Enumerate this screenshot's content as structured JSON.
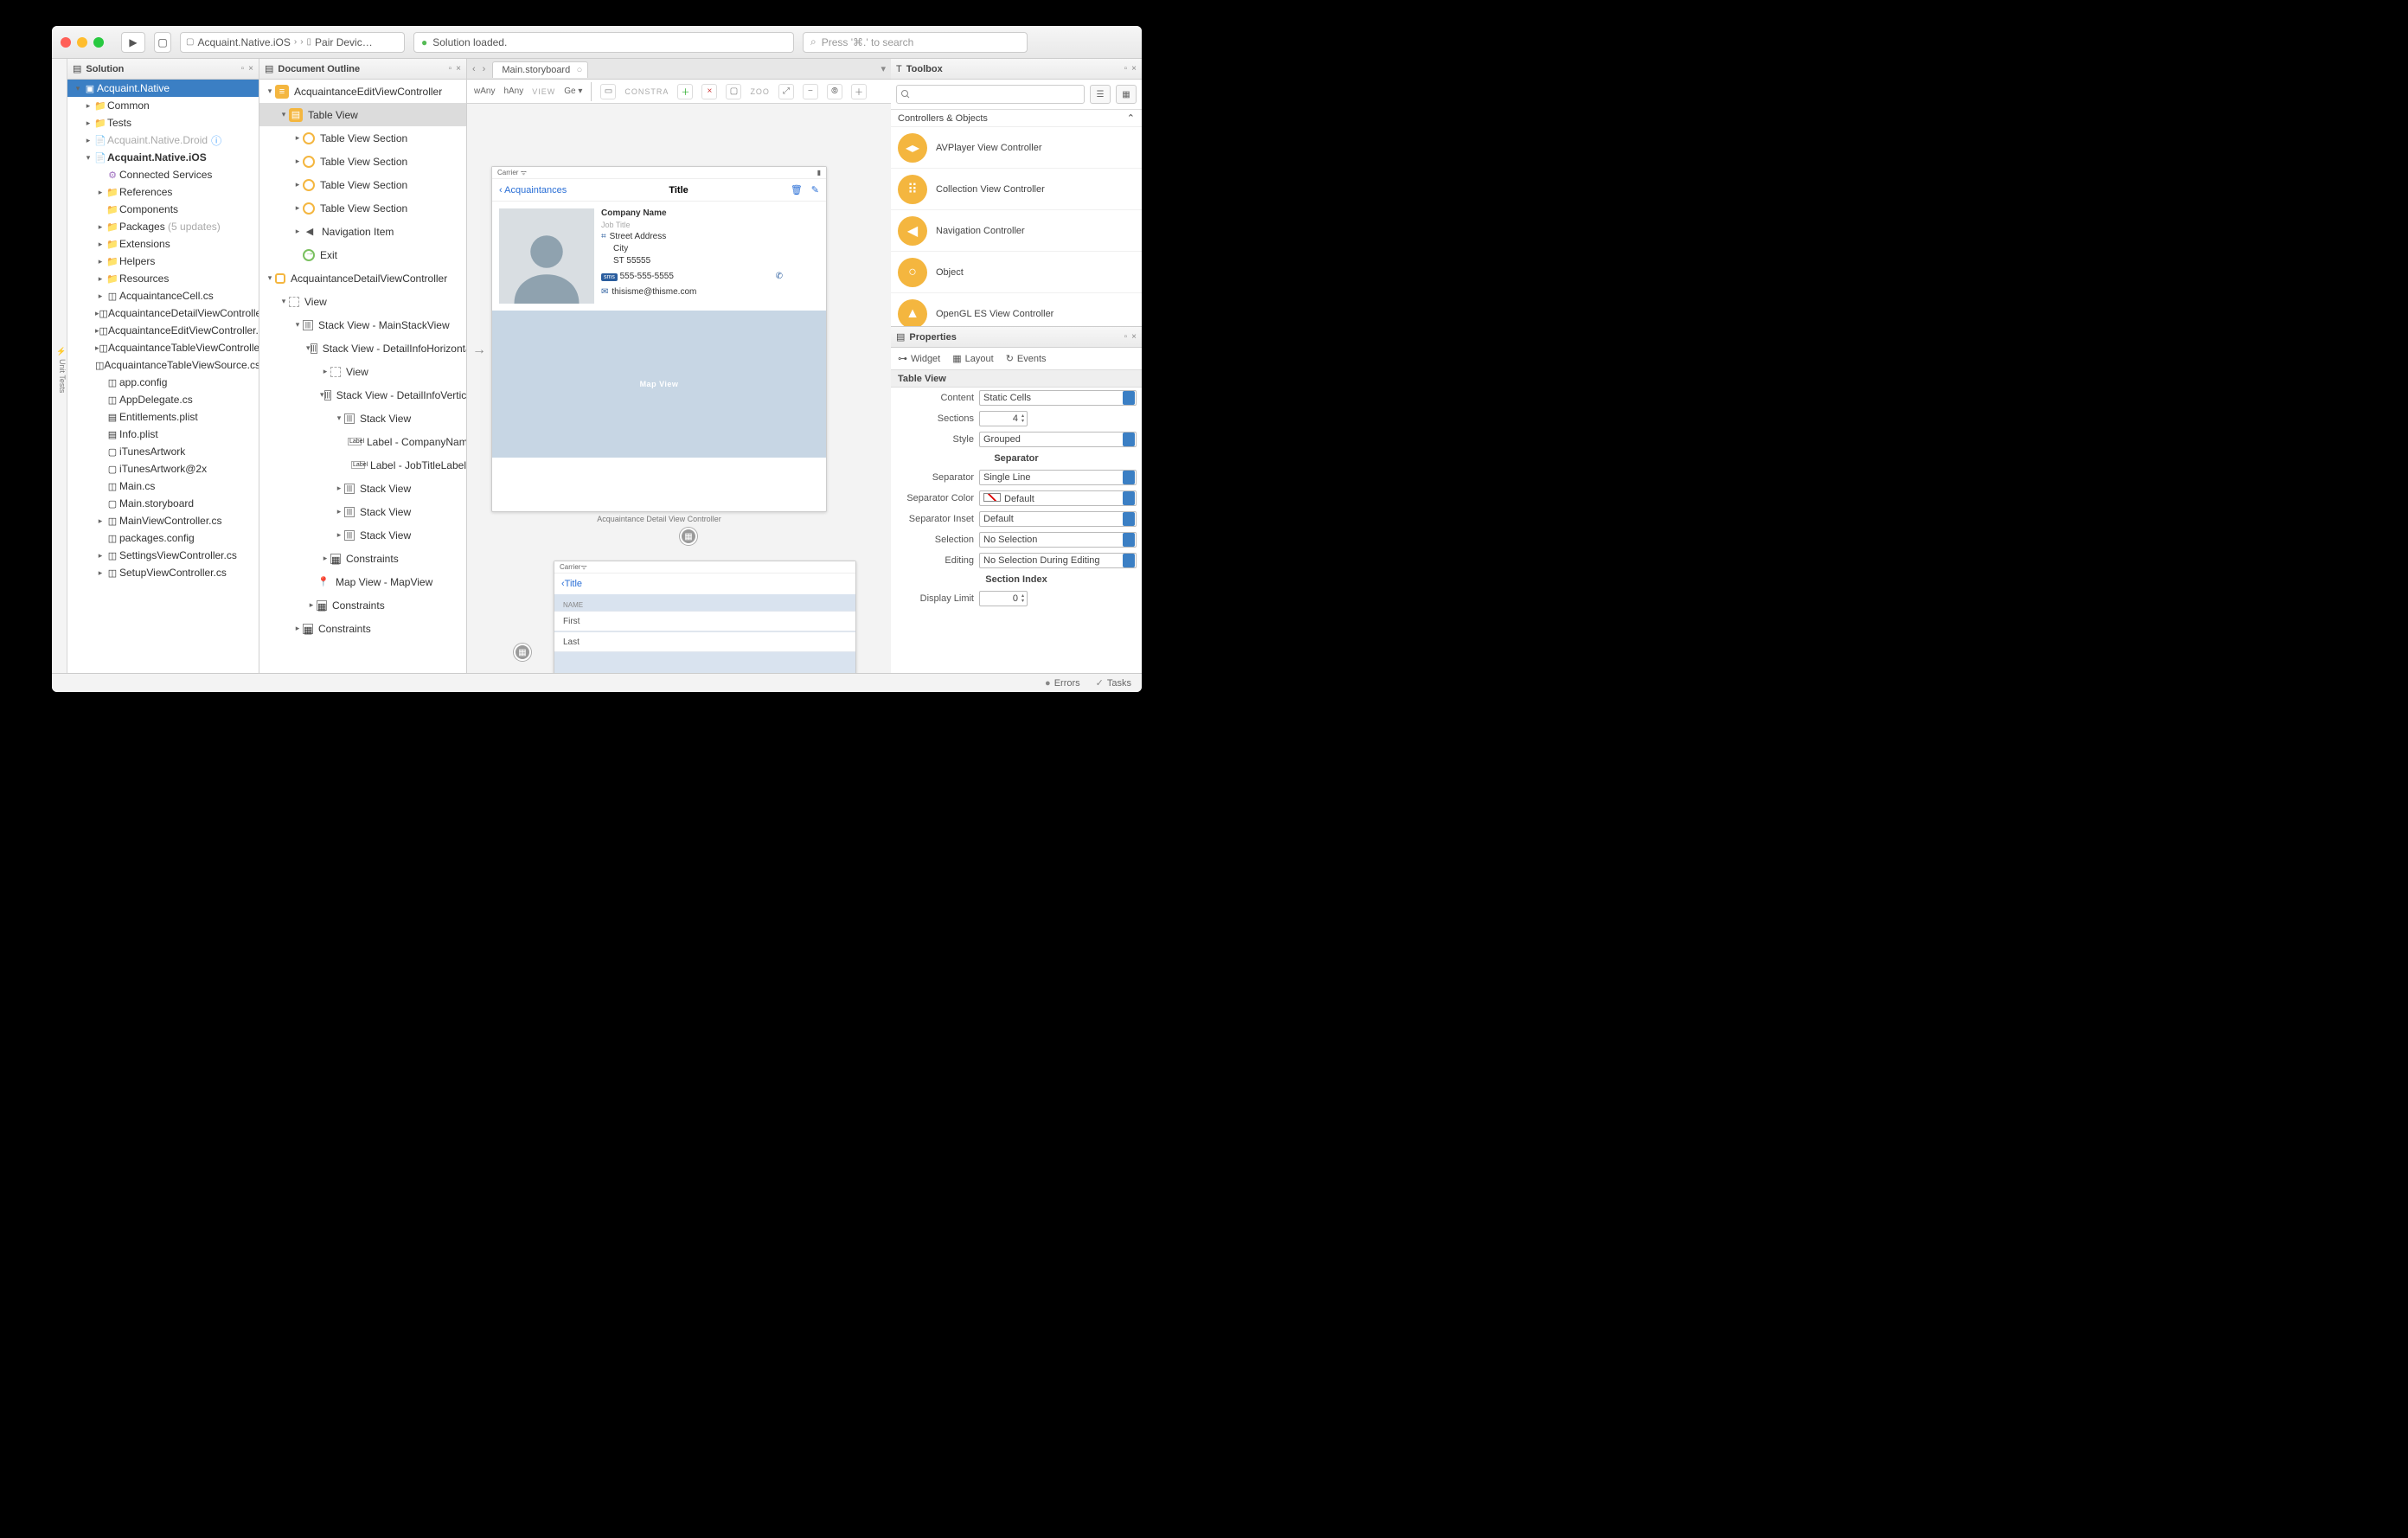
{
  "titlebar": {
    "breadcrumb_project": "Acquaint.Native.iOS",
    "breadcrumb_file": "Pair Devic…",
    "status": "Solution loaded.",
    "search_placeholder": "Press '⌘.' to search"
  },
  "solution": {
    "title": "Solution",
    "root": "Acquaint.Native",
    "items": [
      {
        "label": "Common",
        "ic": "📁",
        "color": "purple",
        "arr": "▸"
      },
      {
        "label": "Tests",
        "ic": "📁",
        "color": "purple",
        "arr": "▸"
      },
      {
        "label": "Acquaint.Native.Droid",
        "ic": "📄",
        "color": "grey",
        "muted": true,
        "arr": "▸",
        "info": true
      },
      {
        "label": "Acquaint.Native.iOS",
        "ic": "📄",
        "color": "grey",
        "bold": true,
        "arr": "▾"
      },
      {
        "label": "Connected Services",
        "ic": "⚙",
        "color": "purple",
        "indent": 1
      },
      {
        "label": "References",
        "ic": "📁",
        "color": "purple",
        "indent": 1,
        "arr": "▸"
      },
      {
        "label": "Components",
        "ic": "📁",
        "color": "purple",
        "indent": 1
      },
      {
        "label": "Packages",
        "suffix": "(5 updates)",
        "ic": "📁",
        "color": "purple",
        "indent": 1,
        "arr": "▸"
      },
      {
        "label": "Extensions",
        "ic": "📁",
        "color": "blue",
        "indent": 1,
        "arr": "▸"
      },
      {
        "label": "Helpers",
        "ic": "📁",
        "color": "blue",
        "indent": 1,
        "arr": "▸"
      },
      {
        "label": "Resources",
        "ic": "📁",
        "color": "blue",
        "indent": 1,
        "arr": "▸"
      },
      {
        "label": "AcquaintanceCell.cs",
        "ic": "◫",
        "indent": 1,
        "arr": "▸"
      },
      {
        "label": "AcquaintanceDetailViewController.cs",
        "ic": "◫",
        "indent": 1,
        "arr": "▸"
      },
      {
        "label": "AcquaintanceEditViewController.cs",
        "ic": "◫",
        "indent": 1,
        "arr": "▸"
      },
      {
        "label": "AcquaintanceTableViewController.cs",
        "ic": "◫",
        "indent": 1,
        "arr": "▸"
      },
      {
        "label": "AcquaintanceTableViewSource.cs",
        "ic": "◫",
        "indent": 1
      },
      {
        "label": "app.config",
        "ic": "◫",
        "indent": 1
      },
      {
        "label": "AppDelegate.cs",
        "ic": "◫",
        "indent": 1
      },
      {
        "label": "Entitlements.plist",
        "ic": "▤",
        "indent": 1
      },
      {
        "label": "Info.plist",
        "ic": "▤",
        "indent": 1
      },
      {
        "label": "iTunesArtwork",
        "ic": "▢",
        "indent": 1
      },
      {
        "label": "iTunesArtwork@2x",
        "ic": "▢",
        "indent": 1
      },
      {
        "label": "Main.cs",
        "ic": "◫",
        "indent": 1
      },
      {
        "label": "Main.storyboard",
        "ic": "▢",
        "indent": 1
      },
      {
        "label": "MainViewController.cs",
        "ic": "◫",
        "indent": 1,
        "arr": "▸"
      },
      {
        "label": "packages.config",
        "ic": "◫",
        "indent": 1
      },
      {
        "label": "SettingsViewController.cs",
        "ic": "◫",
        "indent": 1,
        "arr": "▸"
      },
      {
        "label": "SetupViewController.cs",
        "ic": "◫",
        "indent": 1,
        "arr": "▸"
      }
    ]
  },
  "outline": {
    "title": "Document Outline",
    "items": [
      {
        "label": "AcquaintanceEditViewController",
        "type": "ctrl",
        "d": 0,
        "arr": "▾"
      },
      {
        "label": "Table View",
        "type": "tbl",
        "d": 1,
        "arr": "▾",
        "sel": true
      },
      {
        "label": "Table View Section",
        "type": "ring",
        "d": 2,
        "arr": "▸"
      },
      {
        "label": "Table View Section",
        "type": "ring",
        "d": 2,
        "arr": "▸"
      },
      {
        "label": "Table View Section",
        "type": "ring",
        "d": 2,
        "arr": "▸"
      },
      {
        "label": "Table View Section",
        "type": "ring",
        "d": 2,
        "arr": "▸"
      },
      {
        "label": "Navigation Item",
        "type": "nav",
        "d": 2,
        "arr": "▸"
      },
      {
        "label": "Exit",
        "type": "exit",
        "d": 2,
        "arr": ""
      },
      {
        "label": "AcquaintanceDetailViewController",
        "type": "sq",
        "d": 0,
        "arr": "▾"
      },
      {
        "label": "View",
        "type": "view",
        "d": 1,
        "arr": "▾"
      },
      {
        "label": "Stack View - MainStackView",
        "type": "stk",
        "d": 2,
        "arr": "▾"
      },
      {
        "label": "Stack View - DetailInfoHorizontal",
        "type": "stk",
        "d": 3,
        "arr": "▾"
      },
      {
        "label": "View",
        "type": "view",
        "d": 4,
        "arr": "▸"
      },
      {
        "label": "Stack View - DetailInfoVertical",
        "type": "stk",
        "d": 4,
        "arr": "▾"
      },
      {
        "label": "Stack View",
        "type": "stk",
        "d": 5,
        "arr": "▾"
      },
      {
        "label": "Label - CompanyNameLabel",
        "type": "lbl",
        "d": 6,
        "arr": ""
      },
      {
        "label": "Label - JobTitleLabel",
        "type": "lbl",
        "d": 6,
        "arr": ""
      },
      {
        "label": "Stack View",
        "type": "stk",
        "d": 5,
        "arr": "▸"
      },
      {
        "label": "Stack View",
        "type": "stk",
        "d": 5,
        "arr": "▸"
      },
      {
        "label": "Stack View",
        "type": "stk",
        "d": 5,
        "arr": "▸"
      },
      {
        "label": "Constraints",
        "type": "con",
        "d": 4,
        "arr": "▸"
      },
      {
        "label": "Map View - MapView",
        "type": "map",
        "d": 3,
        "arr": ""
      },
      {
        "label": "Constraints",
        "type": "con",
        "d": 3,
        "arr": "▸"
      },
      {
        "label": "Constraints",
        "type": "con",
        "d": 2,
        "arr": "▸"
      }
    ]
  },
  "designer": {
    "tab": "Main.storyboard",
    "size_w": "wAny",
    "size_h": "hAny",
    "view_lbl": "VIEW",
    "view_val": "Ge",
    "constr": "CONSTRA",
    "zoom": "ZOO",
    "scene1": {
      "carrier": "Carrier",
      "back": "Acquaintances",
      "title": "Title",
      "company": "Company Name",
      "job": "Job Title",
      "street": "Street Address",
      "city": "City",
      "zip": "ST 55555",
      "phone": "555-555-5555",
      "email": "thisisme@thisme.com",
      "map": "Map View",
      "caption": "Acquaintance Detail View Controller"
    },
    "scene2": {
      "carrier": "Carrier",
      "back": "Title",
      "sec": "NAME",
      "row1": "First",
      "row2": "Last"
    }
  },
  "toolbox": {
    "title": "Toolbox",
    "category": "Controllers & Objects",
    "items": [
      {
        "label": "AVPlayer View Controller",
        "glyph": "◂▸"
      },
      {
        "label": "Collection View Controller",
        "glyph": "⠿"
      },
      {
        "label": "Navigation Controller",
        "glyph": "◀"
      },
      {
        "label": "Object",
        "glyph": "○"
      },
      {
        "label": "OpenGL ES View Controller",
        "glyph": "▲"
      }
    ]
  },
  "properties": {
    "title": "Properties",
    "tabs": {
      "widget": "Widget",
      "layout": "Layout",
      "events": "Events"
    },
    "section": "Table View",
    "content_lbl": "Content",
    "content_val": "Static Cells",
    "sections_lbl": "Sections",
    "sections_val": "4",
    "style_lbl": "Style",
    "style_val": "Grouped",
    "separator_hdr": "Separator",
    "sep_lbl": "Separator",
    "sep_val": "Single Line",
    "sepc_lbl": "Separator Color",
    "sepc_val": "Default",
    "sepi_lbl": "Separator Inset",
    "sepi_val": "Default",
    "selection_lbl": "Selection",
    "selection_val": "No Selection",
    "editing_lbl": "Editing",
    "editing_val": "No Selection During Editing",
    "secidx_hdr": "Section Index",
    "display_lbl": "Display Limit",
    "display_val": "0"
  },
  "status": {
    "errors": "Errors",
    "tasks": "Tasks"
  },
  "sidepanel": "Unit Tests"
}
